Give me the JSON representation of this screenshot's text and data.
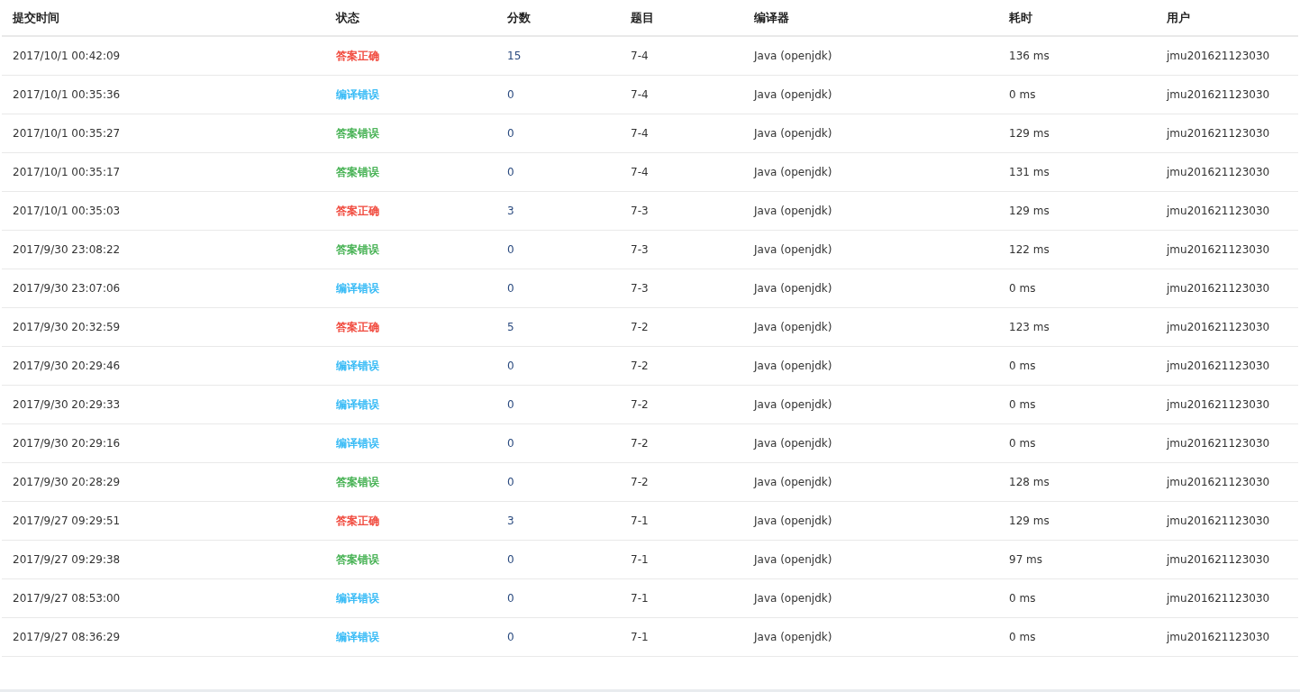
{
  "table": {
    "columns": [
      "提交时间",
      "状态",
      "分数",
      "题目",
      "编译器",
      "耗时",
      "用户"
    ],
    "rows": [
      {
        "time": "2017/10/1 00:42:09",
        "status": "答案正确",
        "color": "#f04134",
        "score": "15",
        "problem": "7-4",
        "compiler": "Java (openjdk)",
        "duration": "136 ms",
        "user": "jmu201621123030"
      },
      {
        "time": "2017/10/1 00:35:36",
        "status": "编译错误",
        "color": "#2db7f5",
        "score": "0",
        "problem": "7-4",
        "compiler": "Java (openjdk)",
        "duration": "0 ms",
        "user": "jmu201621123030"
      },
      {
        "time": "2017/10/1 00:35:27",
        "status": "答案错误",
        "color": "#3dae4b",
        "score": "0",
        "problem": "7-4",
        "compiler": "Java (openjdk)",
        "duration": "129 ms",
        "user": "jmu201621123030"
      },
      {
        "time": "2017/10/1 00:35:17",
        "status": "答案错误",
        "color": "#3dae4b",
        "score": "0",
        "problem": "7-4",
        "compiler": "Java (openjdk)",
        "duration": "131 ms",
        "user": "jmu201621123030"
      },
      {
        "time": "2017/10/1 00:35:03",
        "status": "答案正确",
        "color": "#f04134",
        "score": "3",
        "problem": "7-3",
        "compiler": "Java (openjdk)",
        "duration": "129 ms",
        "user": "jmu201621123030"
      },
      {
        "time": "2017/9/30 23:08:22",
        "status": "答案错误",
        "color": "#3dae4b",
        "score": "0",
        "problem": "7-3",
        "compiler": "Java (openjdk)",
        "duration": "122 ms",
        "user": "jmu201621123030"
      },
      {
        "time": "2017/9/30 23:07:06",
        "status": "编译错误",
        "color": "#2db7f5",
        "score": "0",
        "problem": "7-3",
        "compiler": "Java (openjdk)",
        "duration": "0 ms",
        "user": "jmu201621123030"
      },
      {
        "time": "2017/9/30 20:32:59",
        "status": "答案正确",
        "color": "#f04134",
        "score": "5",
        "problem": "7-2",
        "compiler": "Java (openjdk)",
        "duration": "123 ms",
        "user": "jmu201621123030"
      },
      {
        "time": "2017/9/30 20:29:46",
        "status": "编译错误",
        "color": "#2db7f5",
        "score": "0",
        "problem": "7-2",
        "compiler": "Java (openjdk)",
        "duration": "0 ms",
        "user": "jmu201621123030"
      },
      {
        "time": "2017/9/30 20:29:33",
        "status": "编译错误",
        "color": "#2db7f5",
        "score": "0",
        "problem": "7-2",
        "compiler": "Java (openjdk)",
        "duration": "0 ms",
        "user": "jmu201621123030"
      },
      {
        "time": "2017/9/30 20:29:16",
        "status": "编译错误",
        "color": "#2db7f5",
        "score": "0",
        "problem": "7-2",
        "compiler": "Java (openjdk)",
        "duration": "0 ms",
        "user": "jmu201621123030"
      },
      {
        "time": "2017/9/30 20:28:29",
        "status": "答案错误",
        "color": "#3dae4b",
        "score": "0",
        "problem": "7-2",
        "compiler": "Java (openjdk)",
        "duration": "128 ms",
        "user": "jmu201621123030"
      },
      {
        "time": "2017/9/27 09:29:51",
        "status": "答案正确",
        "color": "#f04134",
        "score": "3",
        "problem": "7-1",
        "compiler": "Java (openjdk)",
        "duration": "129 ms",
        "user": "jmu201621123030"
      },
      {
        "time": "2017/9/27 09:29:38",
        "status": "答案错误",
        "color": "#3dae4b",
        "score": "0",
        "problem": "7-1",
        "compiler": "Java (openjdk)",
        "duration": "97 ms",
        "user": "jmu201621123030"
      },
      {
        "time": "2017/9/27 08:53:00",
        "status": "编译错误",
        "color": "#2db7f5",
        "score": "0",
        "problem": "7-1",
        "compiler": "Java (openjdk)",
        "duration": "0 ms",
        "user": "jmu201621123030"
      },
      {
        "time": "2017/9/27 08:36:29",
        "status": "编译错误",
        "color": "#2db7f5",
        "score": "0",
        "problem": "7-1",
        "compiler": "Java (openjdk)",
        "duration": "0 ms",
        "user": "jmu201621123030"
      }
    ]
  }
}
